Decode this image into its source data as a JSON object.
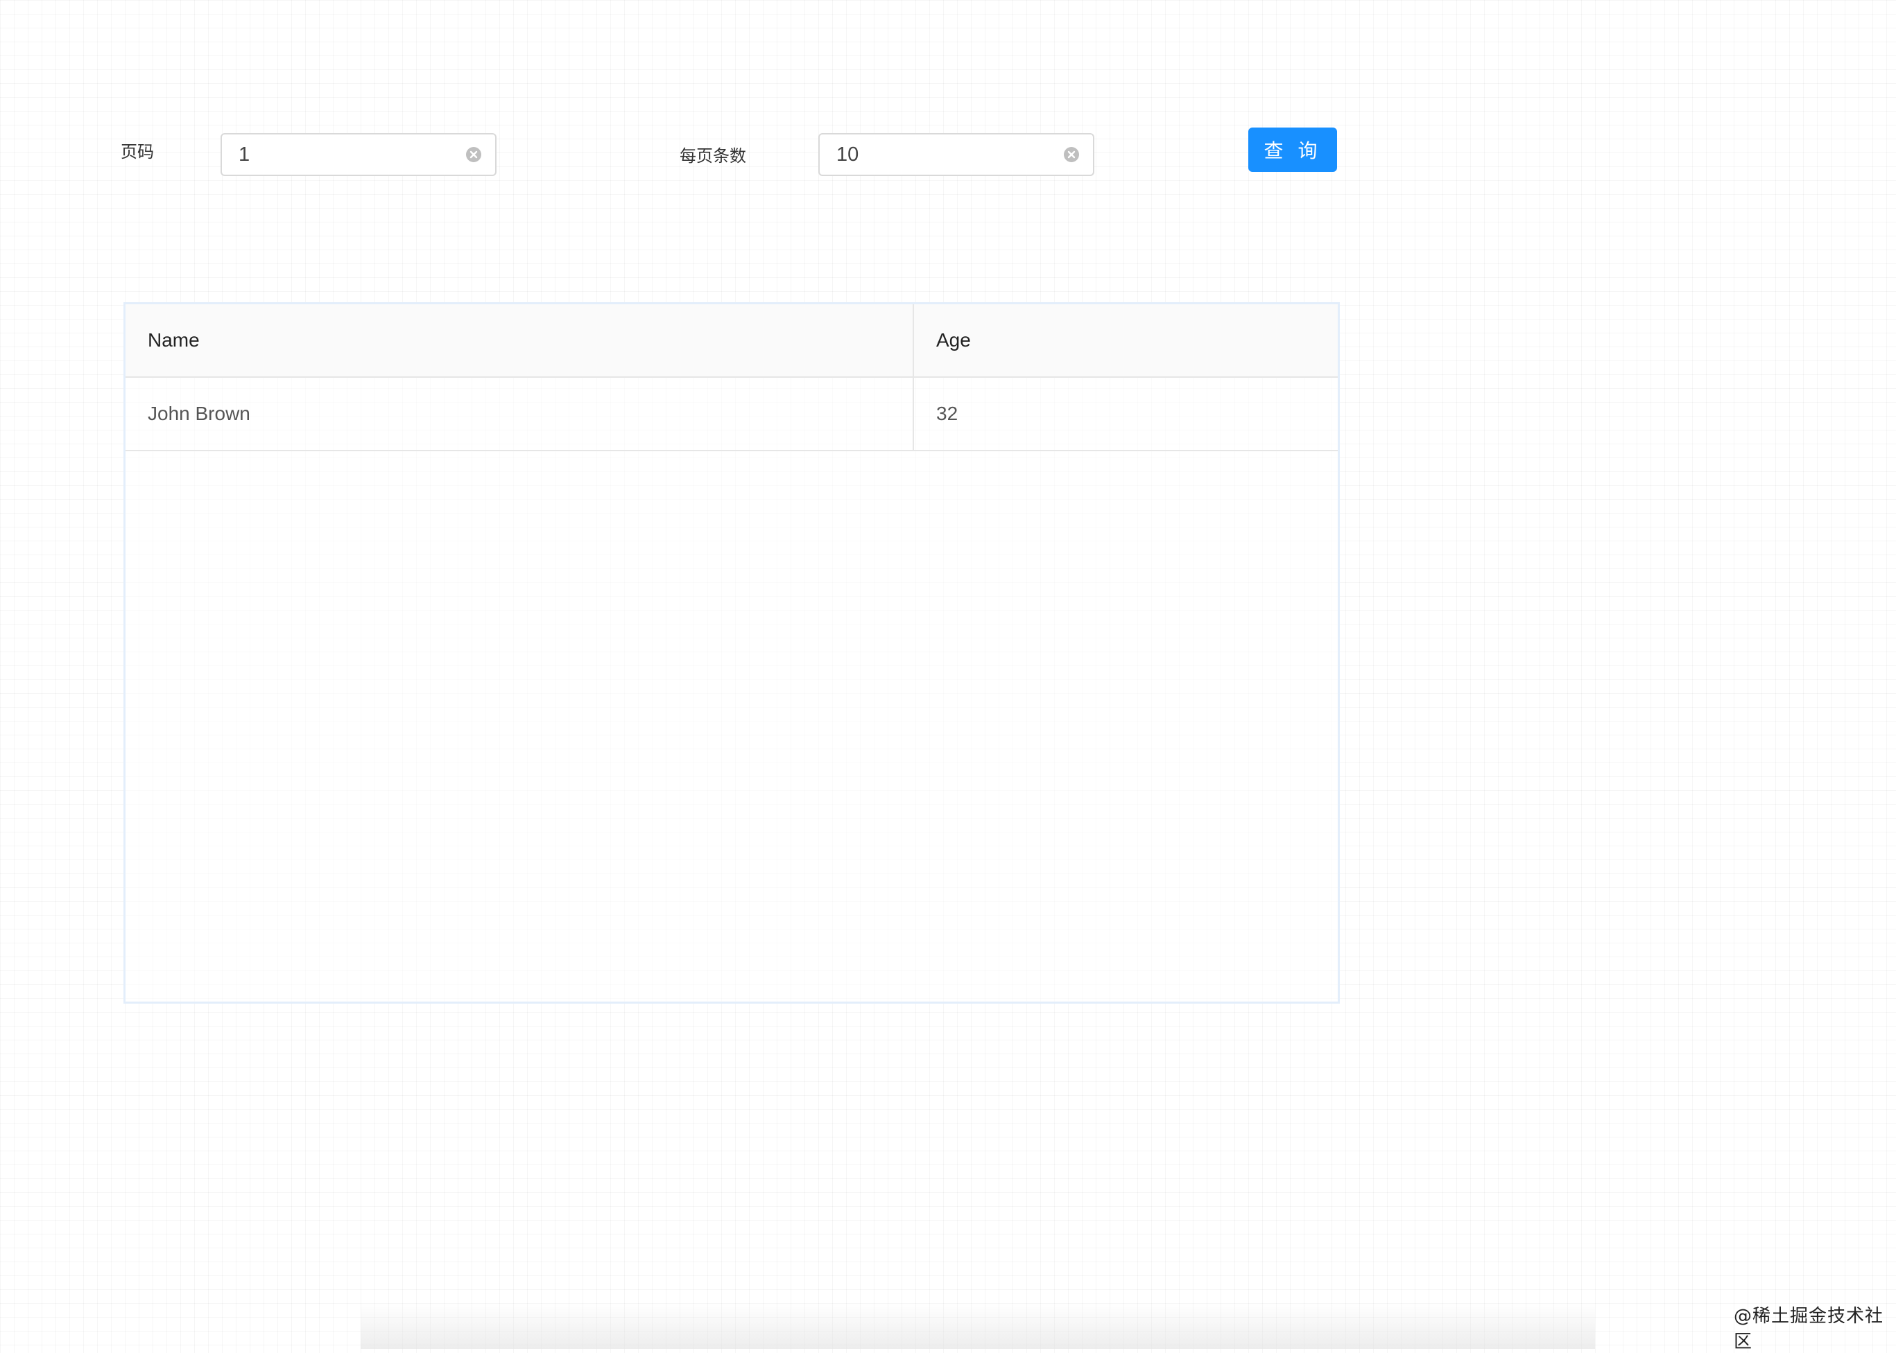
{
  "form": {
    "page_label": "页码",
    "page_value": "1",
    "size_label": "每页条数",
    "size_value": "10",
    "query_label": "查 询"
  },
  "table": {
    "columns": [
      "Name",
      "Age"
    ],
    "rows": [
      [
        "John Brown",
        "32"
      ]
    ]
  },
  "watermark": "@稀土掘金技术社区",
  "colors": {
    "primary": "#1890ff",
    "border": "#d9d9d9",
    "table_border": "#e3eefb"
  },
  "icons": {
    "clear": "close-circle-icon"
  }
}
